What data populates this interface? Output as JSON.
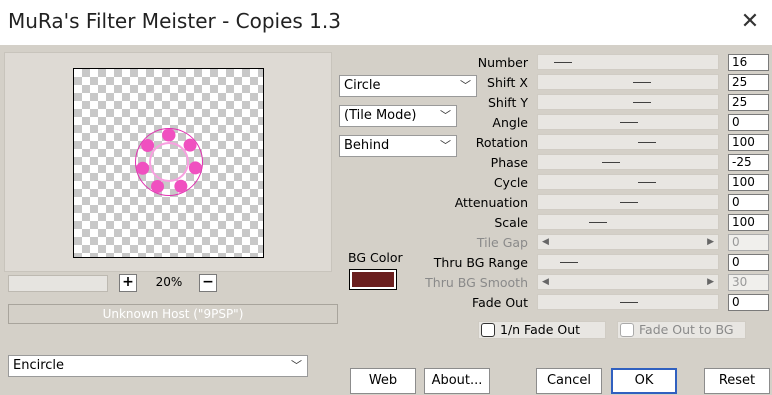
{
  "window": {
    "title": "MuRa's Filter Meister - Copies 1.3",
    "close_icon": "✕"
  },
  "preview": {
    "zoom": "20%",
    "zoom_in": "+",
    "zoom_out": "−",
    "host": "Unknown Host (\"9PSP\")"
  },
  "dropdowns": {
    "shape": "Circle",
    "tile_mode": "(Tile Mode)",
    "placement": "Behind",
    "preset": "Encircle"
  },
  "params": [
    {
      "label": "Number",
      "value": "16",
      "level": 0.14,
      "enabled": true
    },
    {
      "label": "Shift X",
      "value": "25",
      "level": 0.57,
      "enabled": true
    },
    {
      "label": "Shift Y",
      "value": "25",
      "level": 0.57,
      "enabled": true
    },
    {
      "label": "Angle",
      "value": "0",
      "level": 0.5,
      "enabled": true
    },
    {
      "label": "Rotation",
      "value": "100",
      "level": 0.6,
      "enabled": true
    },
    {
      "label": "Phase",
      "value": "-25",
      "level": 0.4,
      "enabled": true
    },
    {
      "label": "Cycle",
      "value": "100",
      "level": 0.6,
      "enabled": true
    },
    {
      "label": "Attenuation",
      "value": "0",
      "level": 0.5,
      "enabled": true
    },
    {
      "label": "Scale",
      "value": "100",
      "level": 0.33,
      "enabled": true
    },
    {
      "label": "Tile Gap",
      "value": "0",
      "level": null,
      "enabled": false
    },
    {
      "label": "Thru BG Range",
      "value": "0",
      "level": 0.17,
      "enabled": true
    },
    {
      "label": "Thru BG Smooth",
      "value": "30",
      "level": null,
      "enabled": false
    },
    {
      "label": "Fade Out",
      "value": "0",
      "level": 0.5,
      "enabled": true
    }
  ],
  "bg_color": {
    "label": "BG Color",
    "value": "#6b1f1f"
  },
  "checkboxes": {
    "fade_1n": "1/n Fade Out",
    "fade_to_bg": "Fade Out to BG"
  },
  "buttons": {
    "web": "Web",
    "about": "About...",
    "cancel": "Cancel",
    "ok": "OK",
    "reset": "Reset"
  }
}
